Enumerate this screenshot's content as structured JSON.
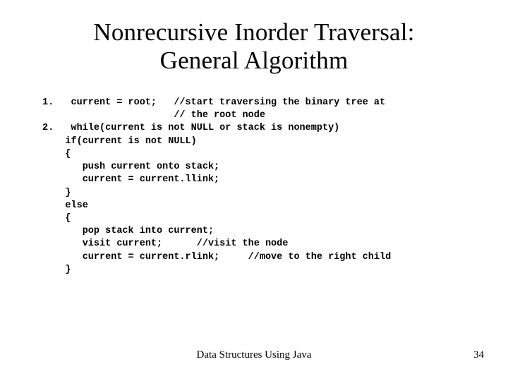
{
  "title_line1": "Nonrecursive Inorder Traversal:",
  "title_line2": "General Algorithm",
  "code": "1.   current = root;   //start traversing the binary tree at\n                       // the root node\n2.   while(current is not NULL or stack is nonempty)\n    if(current is not NULL)\n    {\n       push current onto stack;\n       current = current.llink;\n    }\n    else\n    {\n       pop stack into current;\n       visit current;      //visit the node\n       current = current.rlink;     //move to the right child\n    }",
  "footer_center": "Data Structures Using Java",
  "footer_right": "34"
}
